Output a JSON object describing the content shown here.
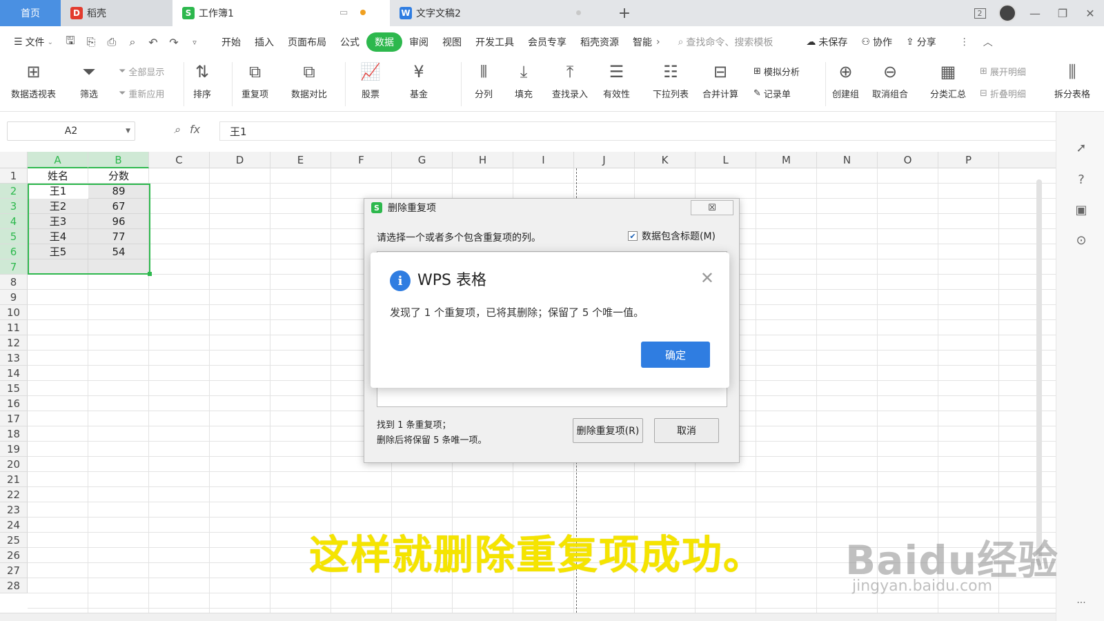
{
  "tabs": {
    "home": "首页",
    "daoke": "稻壳",
    "workbook": "工作簿1",
    "doc": "文字文稿2",
    "new_tab": "+"
  },
  "window": {
    "badge": "2"
  },
  "menu": {
    "file": "文件",
    "items": [
      "开始",
      "插入",
      "页面布局",
      "公式",
      "数据",
      "审阅",
      "视图",
      "开发工具",
      "会员专享",
      "稻壳资源",
      "智能"
    ],
    "active": "数据",
    "search_placeholder": "查找命令、搜索模板",
    "unsaved": "未保存",
    "collab": "协作",
    "share": "分享"
  },
  "ribbon": {
    "pivot": "数据透视表",
    "filter": "筛选",
    "show_all": "全部显示",
    "reapply": "重新应用",
    "sort": "排序",
    "dup": "重复项",
    "compare": "数据对比",
    "stock": "股票",
    "fund": "基金",
    "split": "分列",
    "fill": "填充",
    "lookup": "查找录入",
    "validity": "有效性",
    "dropdown": "下拉列表",
    "consolidate": "合并计算",
    "simulate": "模拟分析",
    "record": "记录单",
    "group": "创建组",
    "ungroup": "取消组合",
    "subtotal": "分类汇总",
    "expand": "展开明细",
    "collapse": "折叠明细",
    "split_table": "拆分表格"
  },
  "formula": {
    "cell_ref": "A2",
    "fx": "fx",
    "value": "王1"
  },
  "sheet": {
    "columns": [
      "A",
      "B",
      "C",
      "D",
      "E",
      "F",
      "G",
      "H",
      "I",
      "J",
      "K",
      "L",
      "M",
      "N",
      "O",
      "P"
    ],
    "rows": [
      "1",
      "2",
      "3",
      "4",
      "5",
      "6",
      "7",
      "8",
      "9",
      "10",
      "11",
      "12",
      "13",
      "14",
      "15",
      "16",
      "17",
      "18",
      "19",
      "20",
      "21",
      "22",
      "23",
      "24",
      "25",
      "26",
      "27",
      "28"
    ],
    "header": [
      "姓名",
      "分数"
    ],
    "data": [
      [
        "王1",
        "89"
      ],
      [
        "王2",
        "67"
      ],
      [
        "王3",
        "96"
      ],
      [
        "王4",
        "77"
      ],
      [
        "王5",
        "54"
      ]
    ],
    "selection": "A2:B7"
  },
  "dialog": {
    "title": "删除重复项",
    "close": "☒",
    "prompt": "请选择一个或者多个包含重复项的列。",
    "has_header": "数据包含标题(M)",
    "has_header_checked": true,
    "status_line1": "找到 1 条重复项；",
    "status_line2": "删除后将保留 5 条唯一项。",
    "remove_btn": "删除重复项(R)",
    "cancel_btn": "取消"
  },
  "message": {
    "title": "WPS 表格",
    "body": "发现了 1 个重复项，已将其删除；保留了 5 个唯一值。",
    "ok": "确定"
  },
  "caption": "这样就删除重复项成功。",
  "watermark": {
    "main": "Baidu经验",
    "sub": "jingyan.baidu.com"
  },
  "colors": {
    "accent_green": "#2db84d",
    "accent_blue": "#2f7de1",
    "caption_yellow": "#f5e400"
  }
}
